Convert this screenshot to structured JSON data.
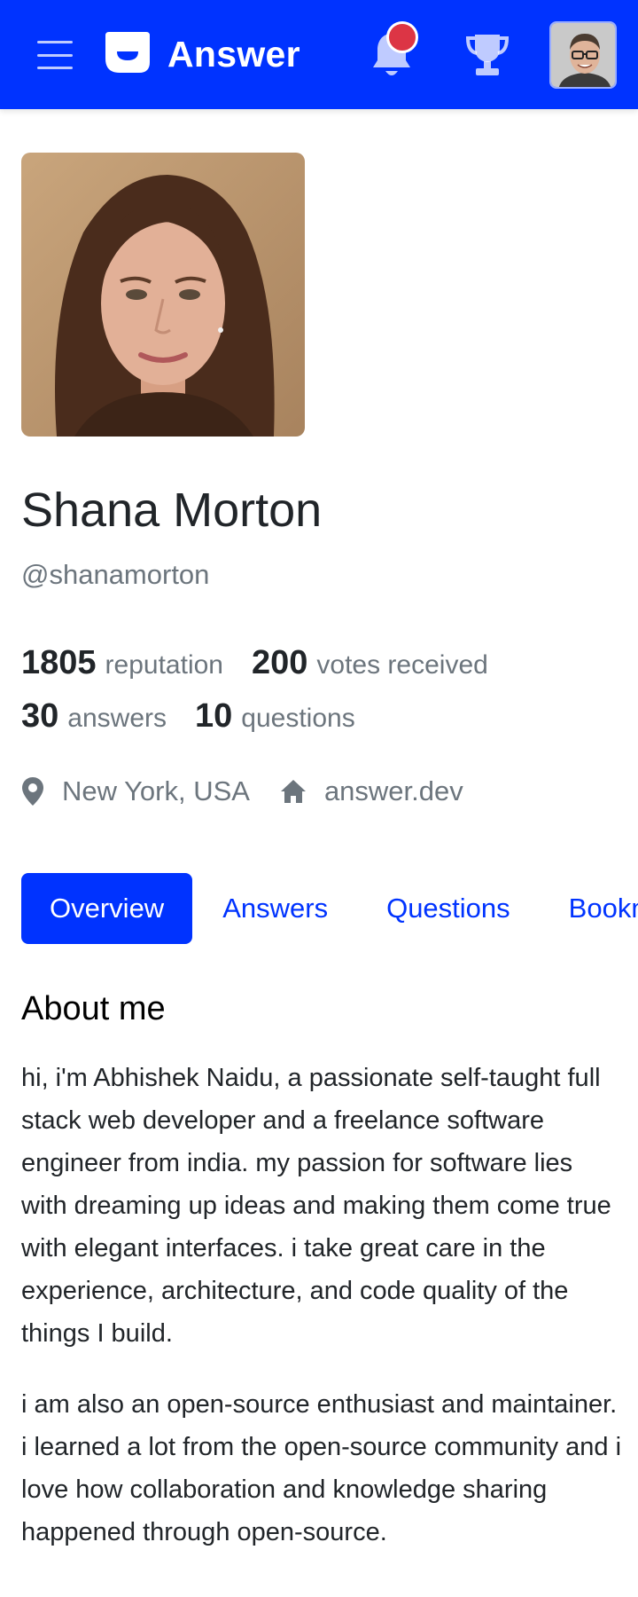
{
  "colors": {
    "brand": "#0033ff",
    "notification_dot": "#dc3545",
    "muted_text": "#6c757d"
  },
  "header": {
    "menu_icon": "hamburger-icon",
    "brand_name": "Answer",
    "logo_icon": "answer-logo-icon",
    "notification_icon": "bell-icon",
    "achievements_icon": "trophy-icon",
    "user_avatar_icon": "user-avatar"
  },
  "profile": {
    "display_name": "Shana Morton",
    "username": "@shanamorton",
    "stats": [
      {
        "value": "1805",
        "label": "reputation"
      },
      {
        "value": "200",
        "label": "votes received"
      },
      {
        "value": "30",
        "label": "answers"
      },
      {
        "value": "10",
        "label": "questions"
      }
    ],
    "location": "New York, USA",
    "website": "answer.dev",
    "location_icon": "map-pin-icon",
    "website_icon": "home-icon"
  },
  "tabs": [
    {
      "label": "Overview",
      "active": true
    },
    {
      "label": "Answers",
      "active": false
    },
    {
      "label": "Questions",
      "active": false
    },
    {
      "label": "Bookmarks",
      "active": false
    }
  ],
  "about": {
    "title": "About me",
    "paragraphs": [
      "hi, i'm Abhishek Naidu, a passionate self-taught full stack web developer and a freelance software engineer from india. my passion for software lies with dreaming up ideas and making them come true with elegant interfaces. i take great care in the experience, architecture, and code quality of the things I build.",
      "i am also an open-source enthusiast and maintainer. i learned a lot from the open-source community and i love how collaboration and knowledge sharing happened through open-source."
    ]
  }
}
